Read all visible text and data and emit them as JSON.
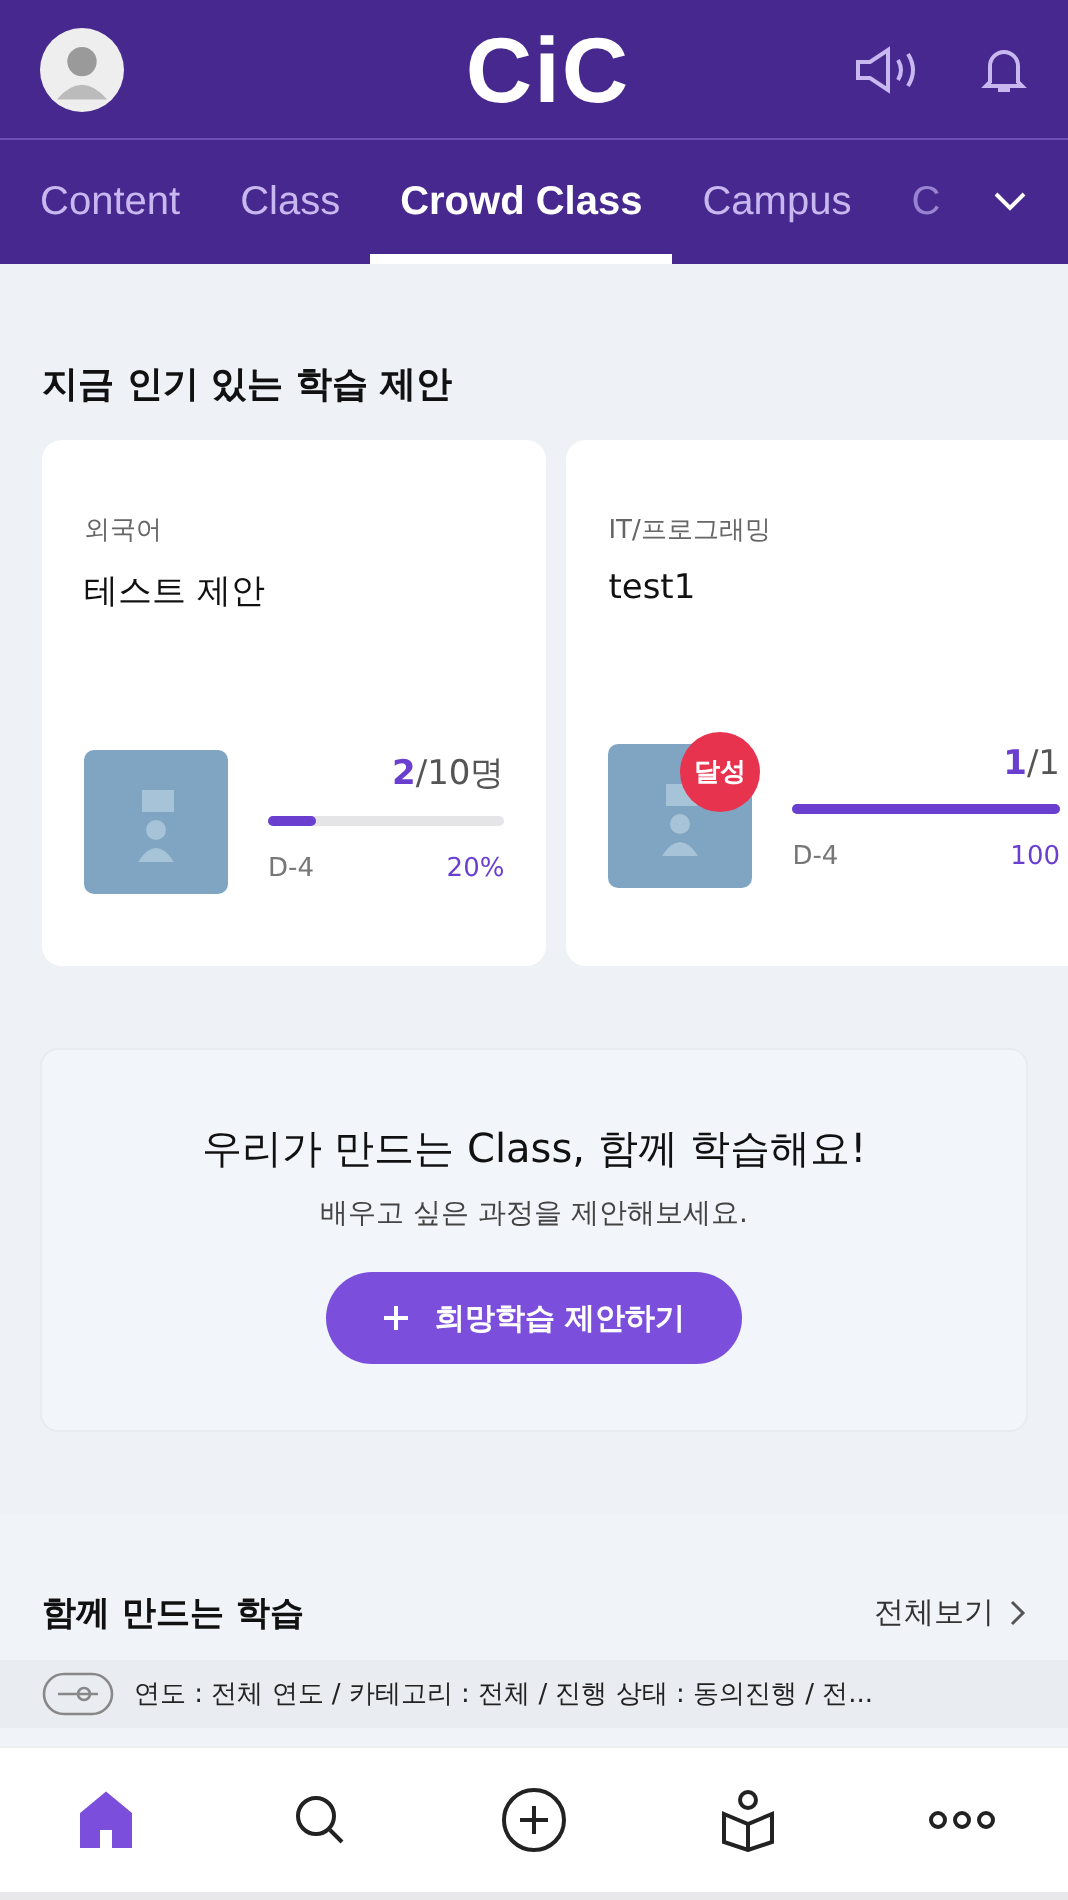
{
  "header": {
    "logo": "CiC"
  },
  "tabs": [
    {
      "label": "Content",
      "selected": false
    },
    {
      "label": "Class",
      "selected": false
    },
    {
      "label": "Crowd Class",
      "selected": true
    },
    {
      "label": "Campus",
      "selected": false
    },
    {
      "label": "C",
      "selected": false
    }
  ],
  "popular": {
    "title": "지금 인기 있는 학습 제안",
    "cards": [
      {
        "category": "외국어",
        "title": "테스트 제안",
        "achieved": false,
        "current": "2",
        "total": "/10명",
        "level": 0.2,
        "days": "D-4",
        "percent": "20%"
      },
      {
        "category": "IT/프로그래밍",
        "title": "test1",
        "achieved": true,
        "badge": "달성",
        "current": "1",
        "total": "/1",
        "level": 1,
        "days": "D-4",
        "percent": "100"
      }
    ]
  },
  "promo": {
    "title": "우리가 만드는 Class, 함께 학습해요!",
    "subtitle": "배우고 싶은 과정을 제안해보세요.",
    "button": "희망학습 제안하기"
  },
  "together": {
    "title": "함께 만드는 학습",
    "view_all": "전체보기",
    "filter": "연도 : 전체 연도 / 카테고리 : 전체 / 진행 상태 : 동의진행 / 전..."
  },
  "bottom_nav": [
    {
      "kind": "home",
      "selected": true
    },
    {
      "kind": "search",
      "selected": false
    },
    {
      "kind": "add",
      "selected": false
    },
    {
      "kind": "learning",
      "selected": false
    },
    {
      "kind": "more",
      "selected": false
    }
  ]
}
